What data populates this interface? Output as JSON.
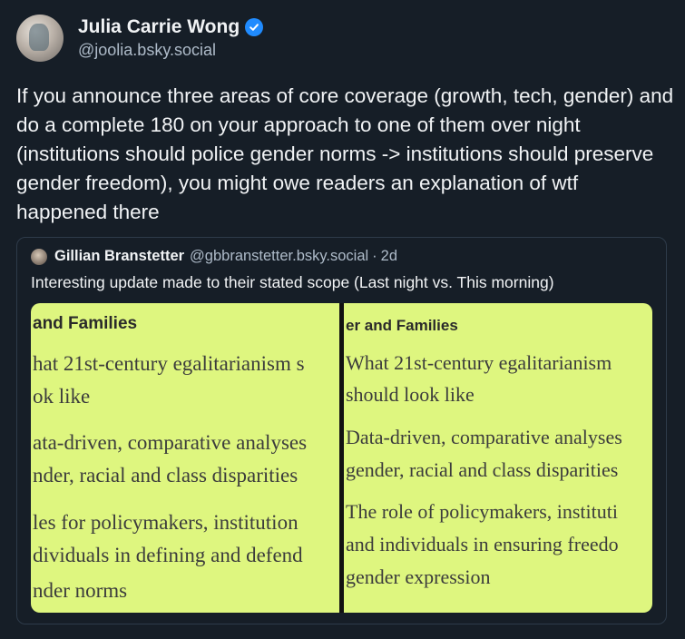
{
  "author": {
    "display_name": "Julia Carrie Wong",
    "handle": "@joolia.bsky.social",
    "verified_icon": "verified-check-icon",
    "verified_color": "#208bfe"
  },
  "post": {
    "text": "If you announce three areas of core coverage (growth, tech, gender) and do a complete 180 on your approach to one of them over night (institutions should police gender norms -> institutions should preserve gender freedom), you might owe readers an explanation of wtf happened there"
  },
  "quote": {
    "display_name": "Gillian Branstetter",
    "handle": "@gbbranstetter.bsky.social",
    "separator": "·",
    "time": "2d",
    "text": "Interesting update made to their stated scope (Last night vs. This morning)",
    "image": {
      "background_color": "#def67f",
      "left": {
        "heading": "and Families",
        "lines": [
          "hat 21st-century egalitarianism s",
          "ok like",
          "ata-driven, comparative analyses",
          "nder, racial and class disparities",
          "les for policymakers, institution",
          "dividuals in defining and defend",
          "nder norms"
        ]
      },
      "right": {
        "heading": "er and Families",
        "lines": [
          "What 21st-century egalitarianism",
          "should look like",
          "Data-driven, comparative analyses",
          "gender, racial and class disparities",
          "The role of policymakers, instituti",
          "and individuals in ensuring freedo",
          "gender expression"
        ]
      }
    }
  }
}
